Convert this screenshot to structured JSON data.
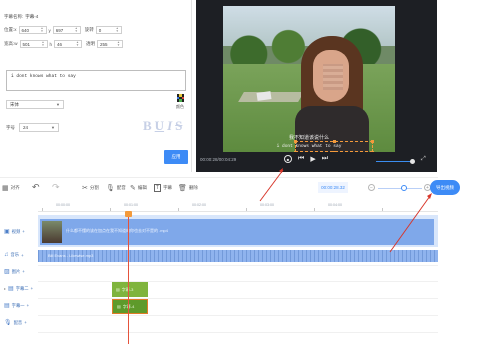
{
  "properties": {
    "name_label": "字幕名称:",
    "name_value": "字幕-4",
    "pos_label": "位置:x",
    "pos_x": "640",
    "pos_y_label": "y",
    "pos_y": "697",
    "rotate_label": "旋转",
    "rotate_value": "0",
    "size_label": "宽高:w",
    "size_w": "501",
    "size_h_label": "h",
    "size_h": "46",
    "opacity_label": "透明",
    "opacity_value": "255",
    "text_value": "i dont knows what to say",
    "font_value": "宋体",
    "color_label": "颜色",
    "fontsize_label": "字号",
    "fontsize_value": "24",
    "style_buttons": [
      "B",
      "U",
      "I",
      "S"
    ],
    "apply_label": "应用"
  },
  "preview": {
    "subtitle_cn": "我不知道该说什么",
    "subtitle_en": "i dont knows what to say",
    "timecode": "00:00:28/00:04:29"
  },
  "toolbar": {
    "undo_label": "",
    "redo_label": "",
    "split_label": "分割",
    "dub_label": "配音",
    "edit_label": "编辑",
    "subtitle_label": "字幕",
    "delete_label": "删除",
    "left_label": "対齐",
    "time_value": "00:00:28.32",
    "export_label": "导出视频"
  },
  "timeline": {
    "ruler": [
      "00:00:00",
      "00:01:00",
      "00:02:00",
      "00:03:00",
      "00:04:00"
    ],
    "tracks": [
      {
        "label": "视频",
        "icon": "video-icon"
      },
      {
        "label": "音乐",
        "icon": "music-icon"
      },
      {
        "label": "图片",
        "icon": "image-icon"
      },
      {
        "label": "字幕二",
        "icon": "subtitle-icon"
      },
      {
        "label": "字幕一",
        "icon": "subtitle-icon"
      },
      {
        "label": "配音",
        "icon": "mic-icon"
      }
    ],
    "video_clip_title": "什么都不懂的该在加点在我不知道的你也去对不是的  .mp4",
    "audio_clip_name": "Bill Evans - Likewise.mp3",
    "subtitle_clip_1": "字幕-3",
    "subtitle_clip_2": "字幕-4"
  }
}
